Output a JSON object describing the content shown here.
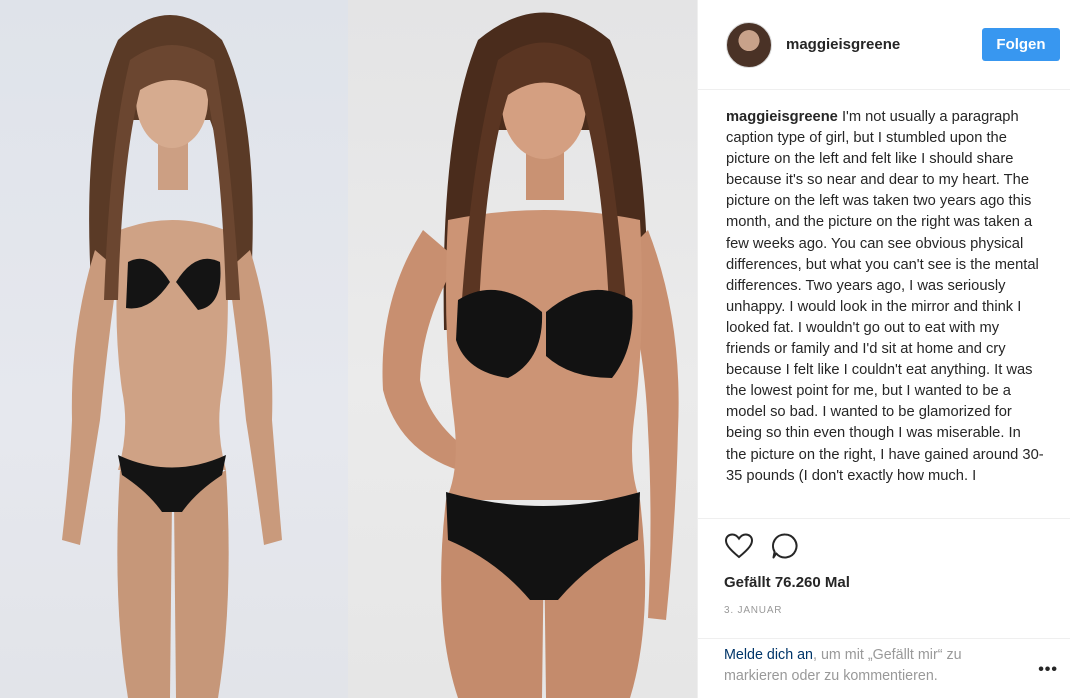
{
  "post": {
    "username": "maggieisgreene",
    "follow_label": "Folgen",
    "caption_user": "maggieisgreene",
    "caption_text": "I'm not usually a paragraph caption type of girl, but I stumbled upon the picture on the left and felt like I should share because it's so near and dear to my heart. The picture on the left was taken two years ago this month, and the picture on the right was taken a few weeks ago. You can see obvious physical differences, but what you can't see is the mental differences. Two years ago, I was seriously unhappy. I would look in the mirror and think I looked fat. I wouldn't go out to eat with my friends or family and I'd sit at home and cry because I felt like I couldn't eat anything. It was the lowest point for me, but I wanted to be a model so bad. I wanted to be glamorized for being so thin even though I was miserable. In the picture on the right, I have gained around 30-35 pounds (I don't exactly how much. I",
    "likes": "Gefällt 76.260 Mal",
    "date": "3. JANUAR",
    "login_link": "Melde dich an",
    "login_rest": ", um mit „Gefällt mir“ zu markieren oder zu kommentieren.",
    "more_label": "•••"
  },
  "icons": {
    "like": "heart-icon",
    "comment": "comment-icon",
    "more": "more-options-icon"
  },
  "colors": {
    "follow_button": "#3897f0",
    "link": "#003569",
    "muted_text": "#999999",
    "text": "#262626",
    "divider": "#efefef"
  }
}
